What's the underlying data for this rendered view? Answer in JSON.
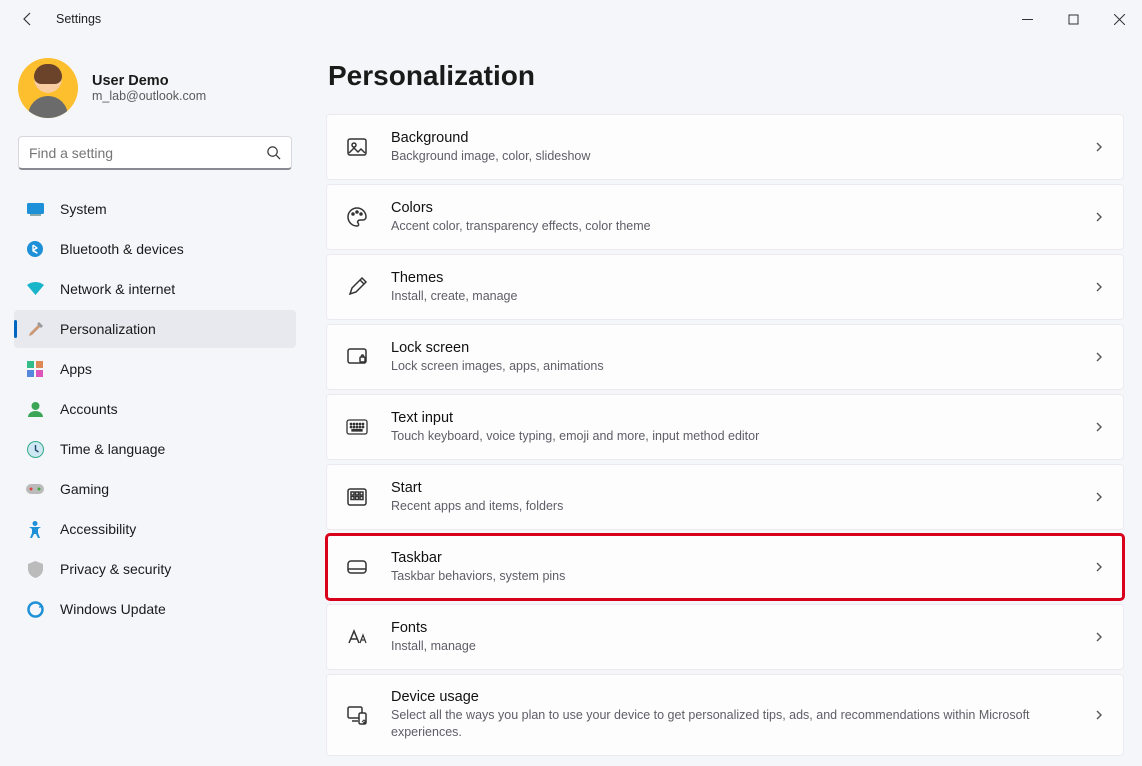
{
  "window": {
    "title": "Settings"
  },
  "user": {
    "name": "User Demo",
    "email": "m_lab@outlook.com"
  },
  "search": {
    "placeholder": "Find a setting"
  },
  "sidebar": {
    "items": [
      {
        "key": "system",
        "label": "System"
      },
      {
        "key": "bluetooth",
        "label": "Bluetooth & devices"
      },
      {
        "key": "network",
        "label": "Network & internet"
      },
      {
        "key": "personalization",
        "label": "Personalization",
        "active": true
      },
      {
        "key": "apps",
        "label": "Apps"
      },
      {
        "key": "accounts",
        "label": "Accounts"
      },
      {
        "key": "time",
        "label": "Time & language"
      },
      {
        "key": "gaming",
        "label": "Gaming"
      },
      {
        "key": "accessibility",
        "label": "Accessibility"
      },
      {
        "key": "privacy",
        "label": "Privacy & security"
      },
      {
        "key": "update",
        "label": "Windows Update"
      }
    ]
  },
  "main": {
    "title": "Personalization",
    "cards": [
      {
        "key": "background",
        "title": "Background",
        "sub": "Background image, color, slideshow"
      },
      {
        "key": "colors",
        "title": "Colors",
        "sub": "Accent color, transparency effects, color theme"
      },
      {
        "key": "themes",
        "title": "Themes",
        "sub": "Install, create, manage"
      },
      {
        "key": "lockscreen",
        "title": "Lock screen",
        "sub": "Lock screen images, apps, animations"
      },
      {
        "key": "textinput",
        "title": "Text input",
        "sub": "Touch keyboard, voice typing, emoji and more, input method editor"
      },
      {
        "key": "start",
        "title": "Start",
        "sub": "Recent apps and items, folders"
      },
      {
        "key": "taskbar",
        "title": "Taskbar",
        "sub": "Taskbar behaviors, system pins",
        "highlight": true
      },
      {
        "key": "fonts",
        "title": "Fonts",
        "sub": "Install, manage"
      },
      {
        "key": "deviceusage",
        "title": "Device usage",
        "sub": "Select all the ways you plan to use your device to get personalized tips, ads, and recommendations within Microsoft experiences."
      }
    ]
  }
}
